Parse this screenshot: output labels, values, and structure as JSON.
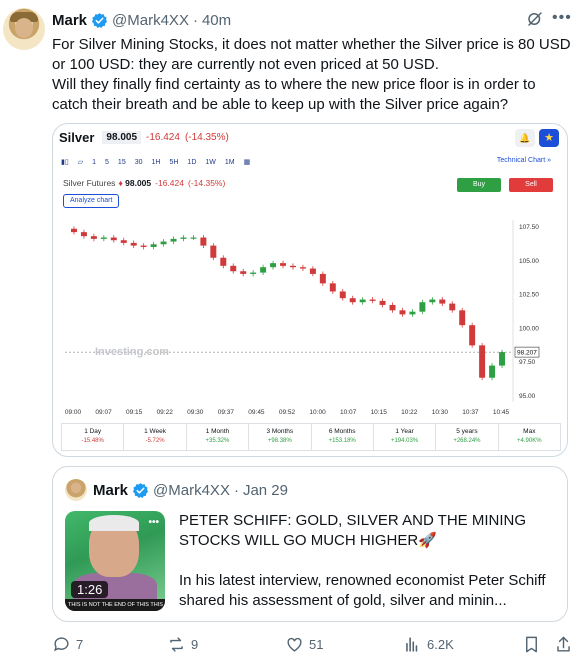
{
  "post": {
    "author_name": "Mark",
    "author_handle": "@Mark4XX",
    "separator": "·",
    "time": "40m",
    "text": "For Silver Mining Stocks, it does not matter whether the Silver price is 80 USD or 100 USD: they are currently not even priced at 50 USD.\nWill they finally find certainty as to where the new price floor is in order to catch their breath and be able to keep up with the Silver price again?"
  },
  "chart_widget": {
    "symbol": "Silver",
    "price": "98.005",
    "change": "-16.424",
    "change_pct": "(-14.35%)",
    "toolbar_items": [
      "1",
      "5",
      "15",
      "30",
      "1H",
      "5H",
      "1D",
      "1W",
      "1M"
    ],
    "active_interval": "1",
    "technical_chart_label": "Technical Chart »",
    "futures_label": "Silver Futures",
    "futures_price": "98.005",
    "futures_change": "-16.424",
    "futures_change_pct": "(-14.35%)",
    "buy_label": "Buy",
    "sell_label": "Sell",
    "analyze_label": "Analyze chart",
    "watermark": "Investing.com",
    "current_price_tag": "98.207",
    "periods": [
      {
        "label": "1 Day",
        "value": "-15.48%",
        "color": "#d03a3a"
      },
      {
        "label": "1 Week",
        "value": "-5.72%",
        "color": "#d03a3a"
      },
      {
        "label": "1 Month",
        "value": "+35.32%",
        "color": "#2ea043"
      },
      {
        "label": "3 Months",
        "value": "+98.38%",
        "color": "#2ea043"
      },
      {
        "label": "6 Months",
        "value": "+153.18%",
        "color": "#2ea043"
      },
      {
        "label": "1 Year",
        "value": "+194.03%",
        "color": "#2ea043"
      },
      {
        "label": "5 years",
        "value": "+268.24%",
        "color": "#2ea043"
      },
      {
        "label": "Max",
        "value": "+4.90K%",
        "color": "#2ea043"
      }
    ]
  },
  "chart_data": {
    "type": "candlestick",
    "x_ticks": [
      "09:00",
      "09:07",
      "09:15",
      "09:22",
      "09:30",
      "09:37",
      "09:45",
      "09:52",
      "10:00",
      "10:07",
      "10:15",
      "10:22",
      "10:30",
      "10:37",
      "10:45"
    ],
    "y_ticks": [
      107.5,
      105.0,
      102.5,
      100.0,
      97.5,
      95.0
    ],
    "ylim": [
      94.5,
      108.0
    ],
    "close_path": [
      107.1,
      106.8,
      106.6,
      106.7,
      106.5,
      106.3,
      106.1,
      106.0,
      106.2,
      106.4,
      106.6,
      106.7,
      106.7,
      106.1,
      105.2,
      104.6,
      104.2,
      104.0,
      104.1,
      104.5,
      104.8,
      104.6,
      104.5,
      104.4,
      104.0,
      103.3,
      102.7,
      102.2,
      101.9,
      102.1,
      102.0,
      101.7,
      101.3,
      101.0,
      101.2,
      101.9,
      102.1,
      101.8,
      101.3,
      100.2,
      98.7,
      96.3,
      97.2,
      98.2
    ],
    "accent_up": "#2ea043",
    "accent_down": "#d03a3a"
  },
  "quote": {
    "author_name": "Mark",
    "author_handle": "@Mark4XX",
    "separator": "·",
    "time": "Jan 29",
    "text": "PETER SCHIFF: GOLD, SILVER AND THE MINING STOCKS WILL GO MUCH HIGHER🚀\n\nIn his latest interview, renowned economist Peter Schiff shared his assessment of gold, silver and minin...",
    "video_duration": "1:26",
    "video_caption": ", THIS IS NOT THE END OF THIS THIS"
  },
  "actions": {
    "replies": "7",
    "reposts": "9",
    "likes": "51",
    "views": "6.2K"
  }
}
